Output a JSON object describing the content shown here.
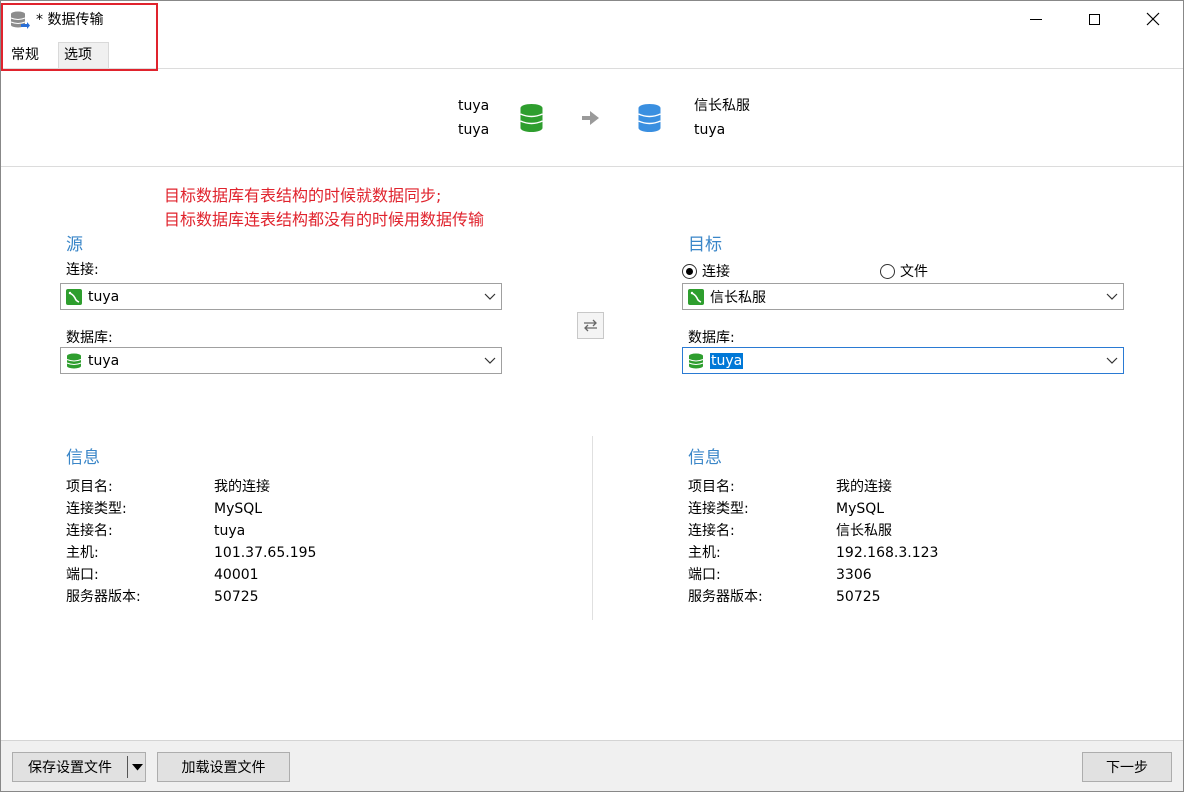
{
  "window": {
    "title": "* 数据传输",
    "icon": "database-transfer-icon",
    "controls": [
      "minimize-icon",
      "maximize-icon",
      "close-icon"
    ]
  },
  "tabs": [
    {
      "label": "常规",
      "active": true
    },
    {
      "label": "选项",
      "active": false
    }
  ],
  "summary": {
    "source": {
      "connection": "tuya",
      "database": "tuya",
      "icon_color": "#2e9e2e"
    },
    "target": {
      "connection": "信长私服",
      "database": "tuya",
      "icon_color": "#3a8fe0"
    }
  },
  "annotation": {
    "line1": "目标数据库有表结构的时候就数据同步;",
    "line2": "目标数据库连表结构都没有的时候用数据传输",
    "color": "#e0232d"
  },
  "source": {
    "title": "源",
    "connection_label": "连接:",
    "connection_value": "tuya",
    "database_label": "数据库:",
    "database_value": "tuya"
  },
  "target": {
    "title": "目标",
    "radio_connection": "连接",
    "radio_file": "文件",
    "radio_selected": "连接",
    "connection_value": "信长私服",
    "database_label": "数据库:",
    "database_value": "tuya"
  },
  "source_info": {
    "title": "信息",
    "rows": [
      {
        "label": "项目名:",
        "value": "我的连接"
      },
      {
        "label": "连接类型:",
        "value": "MySQL"
      },
      {
        "label": "连接名:",
        "value": "tuya"
      },
      {
        "label": "主机:",
        "value": "101.37.65.195"
      },
      {
        "label": "端口:",
        "value": "40001"
      },
      {
        "label": "服务器版本:",
        "value": "50725"
      }
    ]
  },
  "target_info": {
    "title": "信息",
    "rows": [
      {
        "label": "项目名:",
        "value": "我的连接"
      },
      {
        "label": "连接类型:",
        "value": "MySQL"
      },
      {
        "label": "连接名:",
        "value": "信长私服"
      },
      {
        "label": "主机:",
        "value": "192.168.3.123"
      },
      {
        "label": "端口:",
        "value": "3306"
      },
      {
        "label": "服务器版本:",
        "value": "50725"
      }
    ]
  },
  "footer": {
    "save_label": "保存设置文件",
    "load_label": "加载设置文件",
    "next_label": "下一步"
  },
  "colors": {
    "accent": "#3a86c8",
    "highlight": "#0078d7",
    "annotation_red": "#e0232d"
  }
}
